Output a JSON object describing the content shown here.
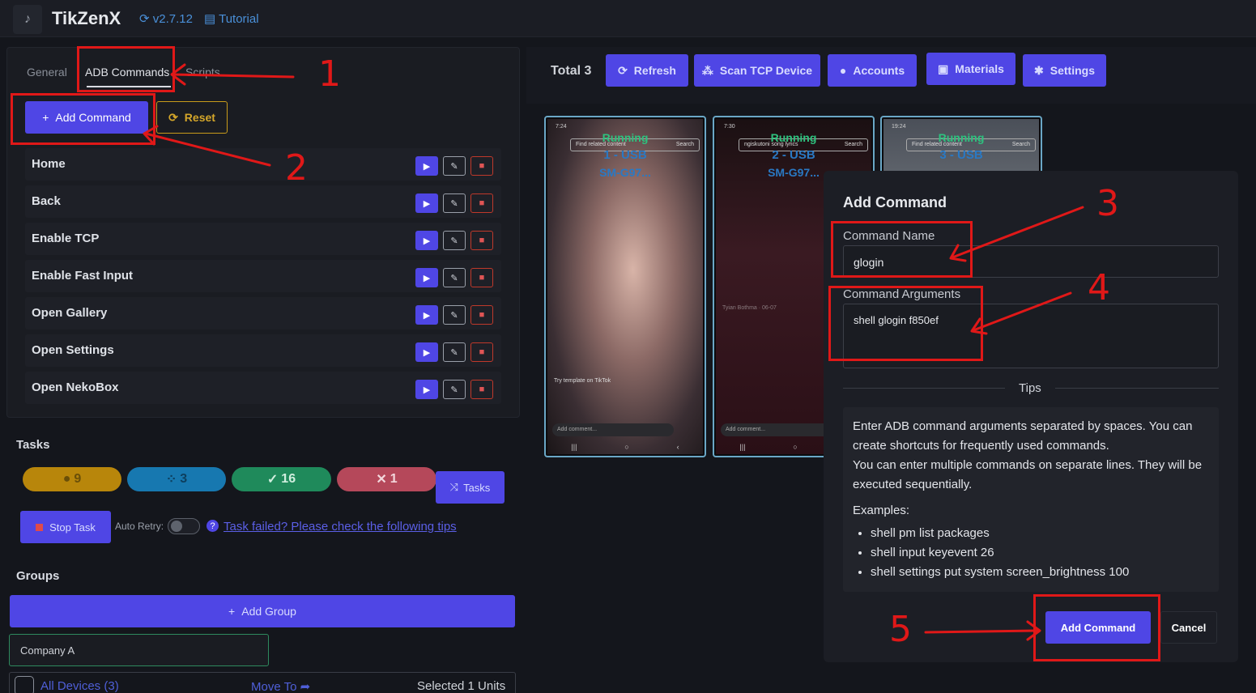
{
  "header": {
    "app_title": "TikZenX",
    "version": "v2.7.12",
    "tutorial": "Tutorial"
  },
  "left_panel": {
    "tabs": [
      "General",
      "ADB Commands",
      "Scripts"
    ],
    "add_command": "Add Command",
    "reset": "Reset",
    "commands": [
      "Home",
      "Back",
      "Enable TCP",
      "Enable Fast Input",
      "Open Gallery",
      "Open Settings",
      "Open NekoBox"
    ]
  },
  "tasks": {
    "title": "Tasks",
    "counts": {
      "pending": "9",
      "running": "3",
      "success": "16",
      "failed": "1"
    },
    "tasks_button": "Tasks",
    "stop_task": "Stop Task",
    "auto_retry": "Auto Retry:",
    "help_link": "Task failed? Please check the following tips"
  },
  "groups": {
    "title": "Groups",
    "add_group": "Add Group",
    "group_name": "Company A",
    "all_devices": "All Devices (3)",
    "move_to": "Move To",
    "selected": "Selected 1 Units"
  },
  "toolbar": {
    "total": "Total 3",
    "buttons": [
      "Refresh",
      "Scan TCP Device",
      "Accounts",
      "Materials",
      "Settings"
    ]
  },
  "devices": [
    {
      "status": "Running",
      "id": "1 - USB",
      "model": "SM-G97...",
      "search": "Find related content",
      "search_btn": "Search",
      "clock": "7:24",
      "caption": "Try template on TikTok"
    },
    {
      "status": "Running",
      "id": "2 - USB",
      "model": "SM-G97...",
      "search": "ngiskutoni song lyrics",
      "search_btn": "Search",
      "clock": "7:30",
      "caption": "Tyian Bothma · 06-07"
    },
    {
      "status": "Running",
      "id": "3 - USB",
      "model": "",
      "search": "Find related content",
      "search_btn": "Search",
      "clock": "19:24",
      "caption": ""
    }
  ],
  "phone_ui": {
    "add_comment": "Add comment..."
  },
  "modal": {
    "title": "Add Command",
    "name_label": "Command Name",
    "name_value": "glogin",
    "args_label": "Command Arguments",
    "args_value": "shell glogin f850ef",
    "tips_label": "Tips",
    "tips_p1": "Enter ADB command arguments separated by spaces. You can create shortcuts for frequently used commands.",
    "tips_p2": "You can enter multiple commands on separate lines. They will be executed sequentially.",
    "examples_label": "Examples:",
    "examples": [
      "shell pm list packages",
      "shell input keyevent 26",
      "shell settings put system screen_brightness 100"
    ],
    "submit": "Add Command",
    "cancel": "Cancel"
  },
  "annotations": [
    "1",
    "2",
    "3",
    "4",
    "5"
  ],
  "colors": {
    "accent": "#4f46e5",
    "annotation": "#e01818",
    "running": "#2ec27e",
    "device_id": "#2a79c4"
  }
}
